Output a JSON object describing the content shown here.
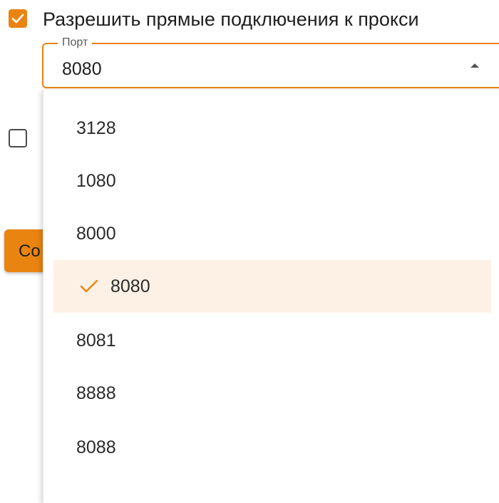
{
  "checkbox_direct": {
    "label": "Разрешить прямые подключения к прокси",
    "checked": true
  },
  "checkbox_second": {
    "checked": false
  },
  "port_field": {
    "legend": "Порт",
    "value": "8080"
  },
  "background_button": {
    "label_visible": "Co"
  },
  "dropdown": {
    "options": [
      {
        "label": "3128",
        "selected": false
      },
      {
        "label": "1080",
        "selected": false
      },
      {
        "label": "8000",
        "selected": false
      },
      {
        "label": "8080",
        "selected": true
      },
      {
        "label": "8081",
        "selected": false
      },
      {
        "label": "8888",
        "selected": false
      },
      {
        "label": "8088",
        "selected": false
      }
    ]
  },
  "colors": {
    "accent": "#ea8410",
    "selected_bg": "#fdf1e6"
  }
}
